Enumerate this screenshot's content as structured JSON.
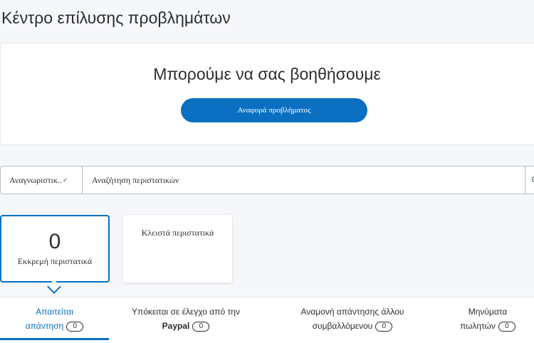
{
  "page": {
    "title": "Κέντρο επίλυσης προβλημάτων"
  },
  "help": {
    "heading": "Μπορούμε να σας βοηθήσουμε",
    "report_button": "Αναφορά προβλήματος"
  },
  "search": {
    "filter_label": "Αναγνωριστικ..",
    "filter_chevron": "✓",
    "placeholder": "Αναζήτηση περιστατικών",
    "icon": "search-icon"
  },
  "cards": {
    "pending": {
      "count": "0",
      "label": "Εκκρεμή περιστατικά"
    },
    "closed": {
      "label": "Κλειστά περιστατικά"
    }
  },
  "tabs": [
    {
      "line1": "Απαιτείται",
      "line2": "απάντηση",
      "count": "0",
      "active": true
    },
    {
      "line1": "Υπόκειται σε έλεγχο από την",
      "line2": "Paypal",
      "count": "0",
      "active": false
    },
    {
      "line1": "Αναμονή απάντησης άλλου",
      "line2": "συμβαλλόμενου",
      "count": "0",
      "active": false
    },
    {
      "line1": "Μηνύματα",
      "line2": "πωλητών",
      "count": "0",
      "active": false
    }
  ],
  "colors": {
    "accent": "#0a6fc0",
    "background": "#f5f7fa",
    "text": "#2c2e2f"
  }
}
